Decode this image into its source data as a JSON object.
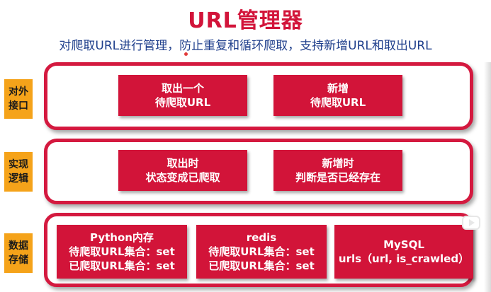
{
  "header": {
    "title": "URL管理器",
    "subtitle": "对爬取URL进行管理，防止重复和循环爬取，支持新增URL和取出URL"
  },
  "rows": [
    {
      "label": "对外\n接口",
      "boxes": [
        {
          "lines": [
            "取出一个",
            "待爬取URL"
          ]
        },
        {
          "lines": [
            "新增",
            "待爬取URL"
          ]
        }
      ]
    },
    {
      "label": "实现\n逻辑",
      "boxes": [
        {
          "lines": [
            "取出时",
            "状态变成已爬取"
          ]
        },
        {
          "lines": [
            "新增时",
            "判断是否已经存在"
          ]
        }
      ]
    },
    {
      "label": "数据\n存储",
      "boxes": [
        {
          "lines": [
            "Python内存",
            "待爬取URL集合：set",
            "已爬取URL集合：set"
          ]
        },
        {
          "lines": [
            "redis",
            "待爬取URL集合：set",
            "已爬取URL集合：set"
          ]
        },
        {
          "lines": [
            "MySQL",
            "urls（url, is_crawled）"
          ]
        }
      ]
    }
  ],
  "colors": {
    "accent_red": "#d21439",
    "label_orange": "#f5a31a",
    "subtitle_blue": "#1f3f8c"
  },
  "icons": [
    "play-logo-icon"
  ]
}
